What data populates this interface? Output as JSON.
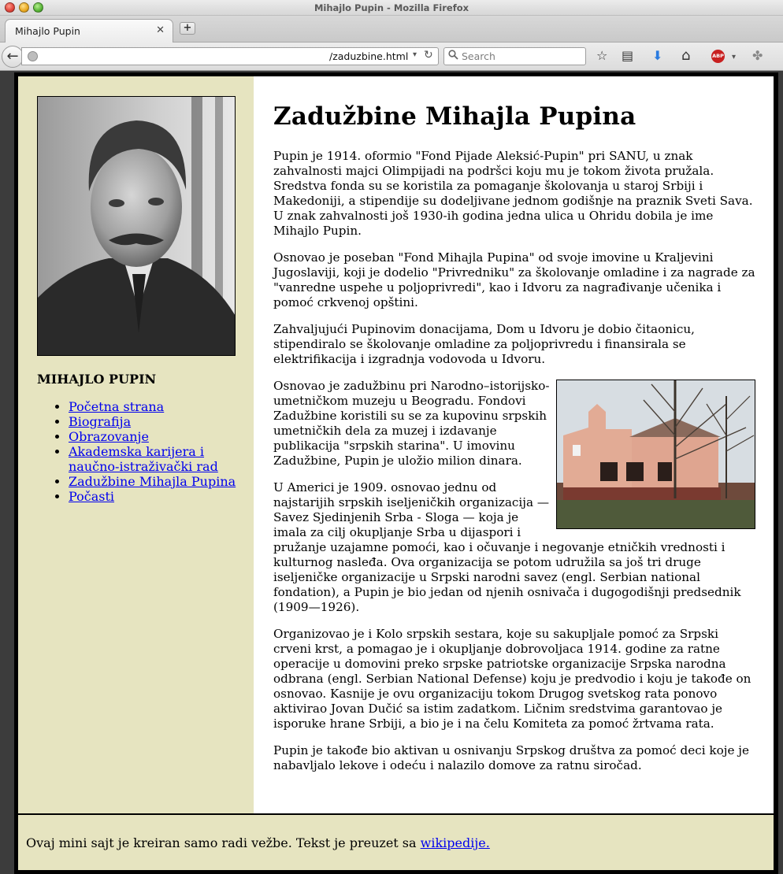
{
  "window": {
    "title": "Mihajlo Pupin - Mozilla Firefox"
  },
  "tabs": [
    {
      "label": "Mihajlo Pupin",
      "close_glyph": "✕"
    }
  ],
  "new_tab_glyph": "+",
  "navigation": {
    "back_glyph": "←",
    "url": "/zaduzbine.html",
    "url_dropdown_glyph": "▾",
    "reload_glyph": "↻",
    "search_placeholder": "Search"
  },
  "toolbar_icons": [
    "star-icon",
    "reading-list-icon",
    "download-icon",
    "home-icon",
    "adblock-icon",
    "extension-icon"
  ],
  "toolbar_glyphs": {
    "bookmark": "☆",
    "reading_list": "▤",
    "download": "⬇",
    "home": "⌂",
    "adblock": "ABP",
    "adblock_dropdown": "▾",
    "extension": "✤"
  },
  "sidebar": {
    "heading": "MIHAJLO PUPIN",
    "nav": [
      {
        "label": "Početna strana"
      },
      {
        "label": "Biografija"
      },
      {
        "label": "Obrazovanje"
      },
      {
        "label": "Akademska karijera i naučno-istraživački rad"
      },
      {
        "label": "Zadužbine Mihajla Pupina"
      },
      {
        "label": "Počasti"
      }
    ]
  },
  "main": {
    "title": "Zadužbine Mihajla Pupina",
    "paragraphs": [
      "Pupin je 1914. oformio \"Fond Pijade Aleksić-Pupin\" pri SANU, u znak zahvalnosti majci Olimpijadi na podršci koju mu je tokom života pružala. Sredstva fonda su se koristila za pomaganje školovanja u staroj Srbiji i Makedoniji, a stipendije su dodeljivane jednom godišnje na praznik Sveti Sava. U znak zahvalnosti još 1930-ih godina jedna ulica u Ohridu dobila je ime Mihajlo Pupin.",
      "Osnovao je poseban \"Fond Mihajla Pupina\" od svoje imovine u Kraljevini Jugoslaviji, koji je dodelio \"Privredniku\" za školovanje omladine i za nagrade za \"vanredne uspehe u poljoprivredi\", kao i Idvoru za nagrađivanje učenika i pomoć crkvenoj opštini.",
      "Zahvaljujući Pupinovim donacijama, Dom u Idvoru je dobio čitaonicu, stipendiralo se školovanje omladine za poljoprivredu i finansirala se elektrifikacija i izgradnja vodovoda u Idvoru.",
      "Osnovao je zadužbinu pri Narodno–istorijsko-umetničkom muzeju u Beogradu. Fondovi Zadužbine koristili su se za kupovinu srpskih umetničkih dela za muzej i izdavanje publikacija \"srpskih starina\". U imovinu Zadužbine, Pupin je uložio milion dinara.",
      "U Americi je 1909. osnovao jednu od najstarijih srpskih iseljeničkih organizacija — Savez Sjedinjenih Srba - Sloga — koja je imala za cilj okupljanje Srba u dijaspori i pružanje uzajamne pomoći, kao i očuvanje i negovanje etničkih vrednosti i kulturnog nasleđa. Ova organizacija se potom udružila sa još tri druge iseljeničke organizacije u Srpski narodni savez (engl. Serbian national fondation), a Pupin je bio jedan od njenih osnivača i dugogodišnji predsednik (1909—1926).",
      "Organizovao je i Kolo srpskih sestara, koje su sakupljale pomoć za Srpski crveni krst, a pomagao je i okupljanje dobrovoljaca 1914. godine za ratne operacije u domovini preko srpske patriotske organizacije Srpska narodna odbrana (engl. Serbian National Defense) koju je predvodio i koju je takođe on osnovao. Kasnije je ovu organizaciju tokom Drugog svetskog rata ponovo aktivirao Jovan Dučić sa istim zadatkom. Ličnim sredstvima garantovao je isporuke hrane Srbiji, a bio je i na čelu Komiteta za pomoć žrtvama rata.",
      "Pupin je takođe bio aktivan u osnivanju Srpskog društva za pomoć deci koje je nabavljalo lekove i odeću i nalazilo domove za ratnu siročad."
    ]
  },
  "footer": {
    "text": "Ovaj mini sajt je kreiran samo radi vežbe. Tekst je preuzet sa ",
    "link_label": "wikipedije."
  },
  "colors": {
    "sidebar_bg": "#e6e4c0",
    "link": "#0000ee",
    "frame": "#000000"
  }
}
